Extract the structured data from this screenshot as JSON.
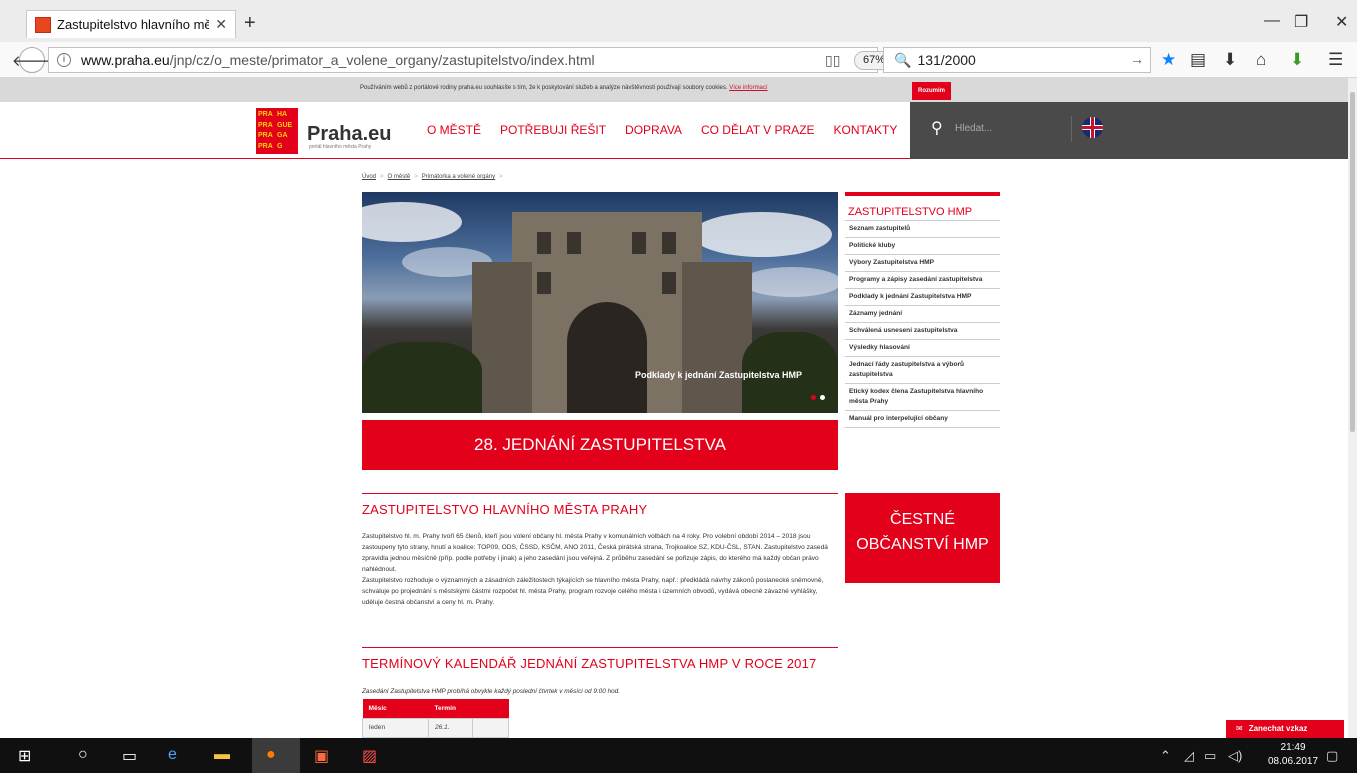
{
  "browser": {
    "tab_title": "Zastupitelstvo hlavního měst",
    "new_tab": "+",
    "tab_close": "✕",
    "win_min": "—",
    "win_max": "❐",
    "win_close": "✕",
    "url_domain": "www.praha.eu",
    "url_path": "/jnp/cz/o_meste/primator_a_volene_organy/zastupitelstvo/index.html",
    "zoom": "67%",
    "search_value": "131/2000",
    "accent_color": "#e2001a"
  },
  "cookie": {
    "text": "Používáním webů z portálové rodiny praha.eu souhlasíte s tím, že k poskytování služeb a analýze návštěvnosti používají soubory cookies.",
    "link": "Více informací",
    "button": "Rozumím"
  },
  "header": {
    "logo_rows": [
      [
        "PRA",
        "HA"
      ],
      [
        "PRA",
        "GUE"
      ],
      [
        "PRA",
        "GA"
      ],
      [
        "PRA",
        "G"
      ]
    ],
    "logo_name": "Praha.eu",
    "logo_sub": "portál hlavního města Prahy",
    "nav": [
      "O MĚSTĚ",
      "POTŘEBUJI ŘEŠIT",
      "DOPRAVA",
      "CO DĚLAT V PRAZE",
      "KONTAKTY"
    ],
    "search_placeholder": "Hledat..."
  },
  "breadcrumb": [
    "Úvod",
    "O městě",
    "Primátorka a volené orgány"
  ],
  "hero": {
    "caption": "Podklady k jednání Zastupitelstva HMP"
  },
  "jednani_banner": "28. JEDNÁNÍ ZASTUPITELSTVA",
  "main": {
    "section1_title": "ZASTUPITELSTVO HLAVNÍHO MĚSTA PRAHY",
    "paragraph1": "Zastupitelstvo hl. m. Prahy tvoří 65 členů, kteří jsou volení občany hl. města Prahy v komunálních volbách na 4 roky. Pro volební období 2014 – 2018 jsou zastoupeny tyto strany, hnutí a koalice: TOP09, ODS, ČSSD, KSČM, ANO 2011, Česká pirátská strana, Trojkoalice SZ, KDU-ČSL, STAN. Zastupitelstvo zasedá zpravidla jednou měsíčně (příp. podle potřeby i jinak) a jeho zasedání jsou veřejná. Z průběhu zasedání se pořizuje zápis, do kterého má každý občan právo nahlédnout.",
    "paragraph2": "Zastupitelstvo rozhoduje o významných a zásadních záležitostech týkajících se hlavního města Prahy, např.: předkládá návrhy zákonů poslanecké sněmovně, schvaluje po projednání s městskými částmi rozpočet hl. města Prahy, program rozvoje celého města i územních obvodů, vydává obecně závazné vyhlášky, uděluje čestná občanství a ceny hl. m. Prahy.",
    "section2_title": "TERMÍNOVÝ KALENDÁŘ JEDNÁNÍ ZASTUPITELSTVA HMP V ROCE 2017",
    "calendar_note": "Zasedání Zastupitelstva HMP probíhá obvykle každý poslední čtvrtek v měsíci od 9:00 hod.",
    "calendar_headers": [
      "Měsíc",
      "Termín"
    ],
    "calendar_rows": [
      [
        "leden",
        "26.1."
      ]
    ]
  },
  "sidebar": {
    "title": "ZASTUPITELSTVO HMP",
    "items": [
      "Seznam zastupitelů",
      "Politické kluby",
      "Výbory Zastupitelstva HMP",
      "Programy a zápisy zasedání zastupitelstva",
      "Podklady k jednání Zastupitelstva HMP",
      "Záznamy jednání",
      "Schválená usnesení zastupitelstva",
      "Výsledky hlasování",
      "Jednací řády zastupitelstva a výborů zastupitelstva",
      "Etický kodex člena Zastupitelstva hlavního města Prahy",
      "Manuál pro interpelující občany"
    ],
    "cestne_line1": "ČESTNÉ",
    "cestne_line2": "OBČANSTVÍ HMP"
  },
  "feedback_button": "Zanechat vzkaz",
  "taskbar": {
    "time": "21:49",
    "date": "08.06.2017"
  }
}
